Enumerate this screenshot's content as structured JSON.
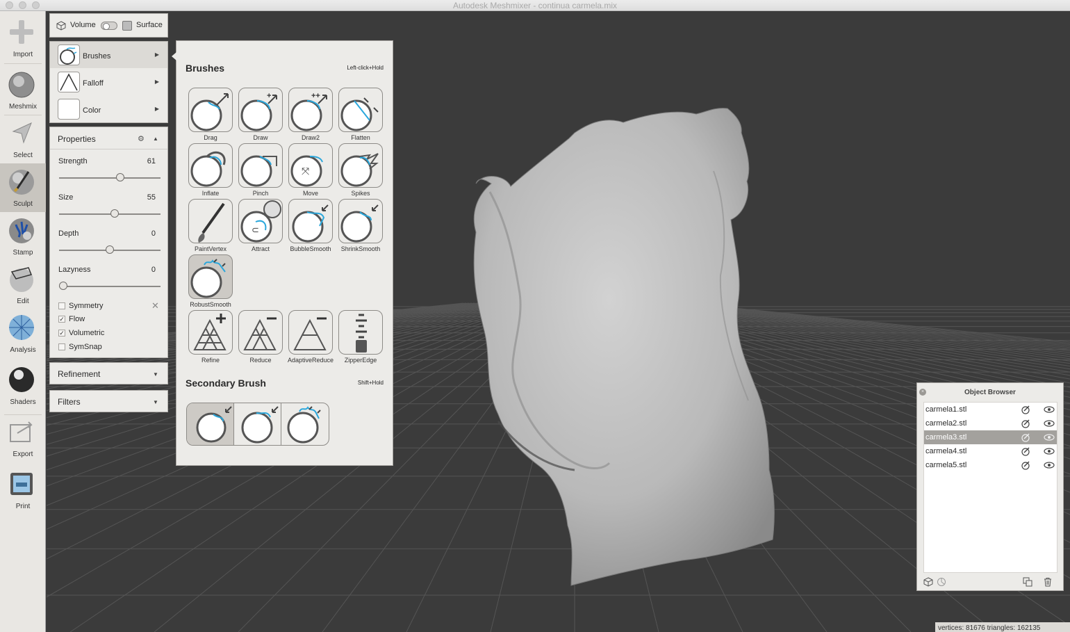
{
  "window": {
    "title": "Autodesk Meshmixer - continua carmela.mix"
  },
  "toolbar": {
    "items": [
      {
        "label": "Import"
      },
      {
        "label": "Meshmix"
      },
      {
        "label": "Select"
      },
      {
        "label": "Sculpt"
      },
      {
        "label": "Stamp"
      },
      {
        "label": "Edit"
      },
      {
        "label": "Analysis"
      },
      {
        "label": "Shaders"
      },
      {
        "label": "Export"
      },
      {
        "label": "Print"
      }
    ],
    "active": "Sculpt"
  },
  "mode": {
    "volume_label": "Volume",
    "surface_label": "Surface"
  },
  "sections": {
    "brushes": "Brushes",
    "falloff": "Falloff",
    "color": "Color"
  },
  "properties": {
    "title": "Properties",
    "strength": {
      "label": "Strength",
      "value": "61",
      "fraction": 0.61
    },
    "size": {
      "label": "Size",
      "value": "55",
      "fraction": 0.55
    },
    "depth": {
      "label": "Depth",
      "value": "0",
      "fraction": 0.5
    },
    "lazyness": {
      "label": "Lazyness",
      "value": "0",
      "fraction": 0.0
    },
    "checks": {
      "symmetry": {
        "label": "Symmetry",
        "checked": false
      },
      "flow": {
        "label": "Flow",
        "checked": true
      },
      "volumetric": {
        "label": "Volumetric",
        "checked": true
      },
      "symsnap": {
        "label": "SymSnap",
        "checked": false
      }
    }
  },
  "refinement": {
    "title": "Refinement"
  },
  "filters": {
    "title": "Filters"
  },
  "brush_popup": {
    "title": "Brushes",
    "hint": "Left-click+Hold",
    "brushes": [
      "Drag",
      "Draw",
      "Draw2",
      "Flatten",
      "Inflate",
      "Pinch",
      "Move",
      "Spikes",
      "PaintVertex",
      "Attract",
      "BubbleSmooth",
      "ShrinkSmooth",
      "RobustSmooth",
      "Refine",
      "Reduce",
      "AdaptiveReduce",
      "ZipperEdge"
    ],
    "selected": "RobustSmooth",
    "secondary_title": "Secondary Brush",
    "secondary_hint": "Shift+Hold",
    "accent_color": "#2aa7dc"
  },
  "object_browser": {
    "title": "Object Browser",
    "close_glyph": "×",
    "objects": [
      "carmela1.stl",
      "carmela2.stl",
      "carmela3.stl",
      "carmela4.stl",
      "carmela5.stl"
    ],
    "selected": "carmela3.stl"
  },
  "status": {
    "text": "vertices: 81676 triangles: 162135"
  }
}
